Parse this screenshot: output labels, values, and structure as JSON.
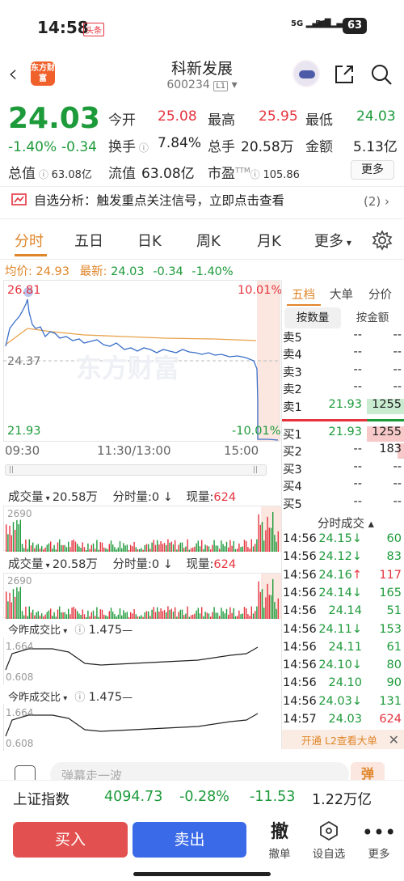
{
  "status": {
    "time": "14:58",
    "badge": "头条",
    "sig1": "5G",
    "sig2": "5G",
    "battery": "63"
  },
  "header": {
    "logo": "东方财富",
    "title": "科新发展",
    "code": "600234",
    "level": "L1"
  },
  "quote": {
    "price": "24.03",
    "pct": "-1.40%",
    "chg": "-0.34",
    "open_label": "今开",
    "open": "25.08",
    "high_label": "最高",
    "high": "25.95",
    "low_label": "最低",
    "low": "24.03",
    "turnover_label": "换手",
    "turnover": "7.84%",
    "volume_label": "总手",
    "volume": "20.58万",
    "amount_label": "金额",
    "amount": "5.13亿",
    "mcap_label": "总值",
    "mcap": "63.08亿",
    "float_label": "流值",
    "float": "63.08亿",
    "pe_label": "市盈",
    "pe_sup": "TTM",
    "pe": "105.86",
    "more": "更多"
  },
  "alert": {
    "text": "自选分析：触发重点关注信号，立即点击查看",
    "count": "(2)"
  },
  "tabs": [
    "分时",
    "五日",
    "日K",
    "周K",
    "月K",
    "更多"
  ],
  "avg": {
    "label": "均价:",
    "value": "24.93",
    "latest_label": "最新:",
    "latest": "24.03",
    "chg": "-0.34",
    "pct": "-1.40%"
  },
  "chart": {
    "ymax": "26.81",
    "ymid": "24.37",
    "ymin": "21.93",
    "pmax": "10.01%",
    "pmin": "-10.01%",
    "t1": "09:30",
    "t2": "11:30/13:00",
    "t3": "15:00",
    "watermark": "东方财富"
  },
  "vol": {
    "label": "成交量",
    "total": "20.58万",
    "period_label": "分时量:0",
    "now_label": "现量:",
    "now": "624",
    "ymax": "2690"
  },
  "ratio": {
    "label": "今昨成交比",
    "value": "1.475",
    "ymax": "1.664",
    "ymin": "0.608"
  },
  "panel": {
    "tabs": [
      "五档",
      "大单",
      "分价"
    ],
    "btn1": "按数量",
    "btn2": "按金额",
    "asks": [
      {
        "label": "卖5",
        "price": "--",
        "vol": "--"
      },
      {
        "label": "卖4",
        "price": "--",
        "vol": "--"
      },
      {
        "label": "卖3",
        "price": "--",
        "vol": "--"
      },
      {
        "label": "卖2",
        "price": "--",
        "vol": "--"
      },
      {
        "label": "卖1",
        "price": "21.93",
        "vol": "1255"
      }
    ],
    "bids": [
      {
        "label": "买1",
        "price": "21.93",
        "vol": "1255"
      },
      {
        "label": "买2",
        "price": "--",
        "vol": "183"
      },
      {
        "label": "买3",
        "price": "--",
        "vol": "--"
      },
      {
        "label": "买4",
        "price": "--",
        "vol": "--"
      },
      {
        "label": "买5",
        "price": "--",
        "vol": "--"
      }
    ],
    "trades_title": "分时成交",
    "trades": [
      {
        "t": "14:56",
        "p": "24.15",
        "d": "↓",
        "v": "60"
      },
      {
        "t": "14:56",
        "p": "24.12",
        "d": "↓",
        "v": "83"
      },
      {
        "t": "14:56",
        "p": "24.16",
        "d": "↑",
        "v": "117"
      },
      {
        "t": "14:56",
        "p": "24.14",
        "d": "↓",
        "v": "165"
      },
      {
        "t": "14:56",
        "p": "24.14",
        "d": "",
        "v": "51"
      },
      {
        "t": "14:56",
        "p": "24.11",
        "d": "↓",
        "v": "153"
      },
      {
        "t": "14:56",
        "p": "24.11",
        "d": "",
        "v": "61"
      },
      {
        "t": "14:56",
        "p": "24.10",
        "d": "↓",
        "v": "80"
      },
      {
        "t": "14:56",
        "p": "24.10",
        "d": "",
        "v": "90"
      },
      {
        "t": "14:56",
        "p": "24.03",
        "d": "↓",
        "v": "131"
      },
      {
        "t": "14:57",
        "p": "24.03",
        "d": "",
        "v": "624"
      }
    ],
    "l2": "开通 L2查看大单"
  },
  "danmu": {
    "placeholder": "弹幕走一波",
    "btn": "弹"
  },
  "index": {
    "name": "上证指数",
    "value": "4094.73",
    "pct": "-0.28%",
    "chg": "-11.53",
    "amount": "1.22万亿"
  },
  "bottom": {
    "buy": "买入",
    "sell": "卖出",
    "cancel": "撤单",
    "cancel_icon": "撤",
    "watch": "设自选",
    "more": "更多"
  },
  "colors": {
    "up": "#e5343f",
    "down": "#1d9a3a",
    "accent": "#e0862a",
    "avg_line": "#e8a14a",
    "price_line": "#3b6fc9"
  }
}
